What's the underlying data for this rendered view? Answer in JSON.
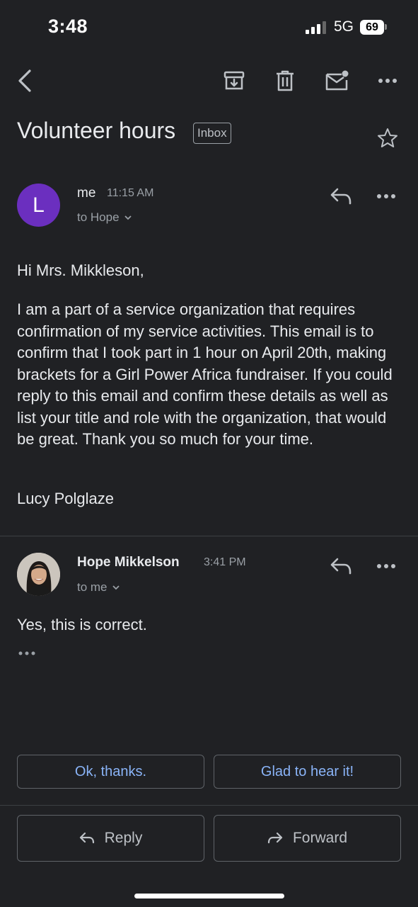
{
  "status_bar": {
    "time": "3:48",
    "network": "5G",
    "battery": "69"
  },
  "toolbar": {
    "icons": [
      "back-icon",
      "archive-icon",
      "trash-icon",
      "mark-unread-icon",
      "more-icon"
    ]
  },
  "subject": "Volunteer hours",
  "label_chip": "Inbox",
  "messages": [
    {
      "avatar_letter": "L",
      "avatar_color": "#6b2fbf",
      "sender": "me",
      "time": "11:15 AM",
      "recipient": "to Hope",
      "greeting": "Hi Mrs. Mikkleson,",
      "body": "I am a part of a service organization that requires confirmation of my service activities. This email is to confirm that I took part in 1 hour on April 20th, making brackets for a Girl Power Africa fundraiser. If you could reply to this email and confirm these details as well as list your title and role with the organization, that would be great. Thank you so much for your time.",
      "signature": "Lucy Polglaze"
    },
    {
      "sender": "Hope Mikkelson",
      "time": "3:41 PM",
      "recipient": "to me",
      "body": "Yes, this is correct."
    }
  ],
  "smart_replies": [
    "Ok, thanks.",
    "Glad to hear it!"
  ],
  "actions": {
    "reply": "Reply",
    "forward": "Forward"
  },
  "colors": {
    "background": "#202124",
    "accent": "#8ab4f8"
  }
}
